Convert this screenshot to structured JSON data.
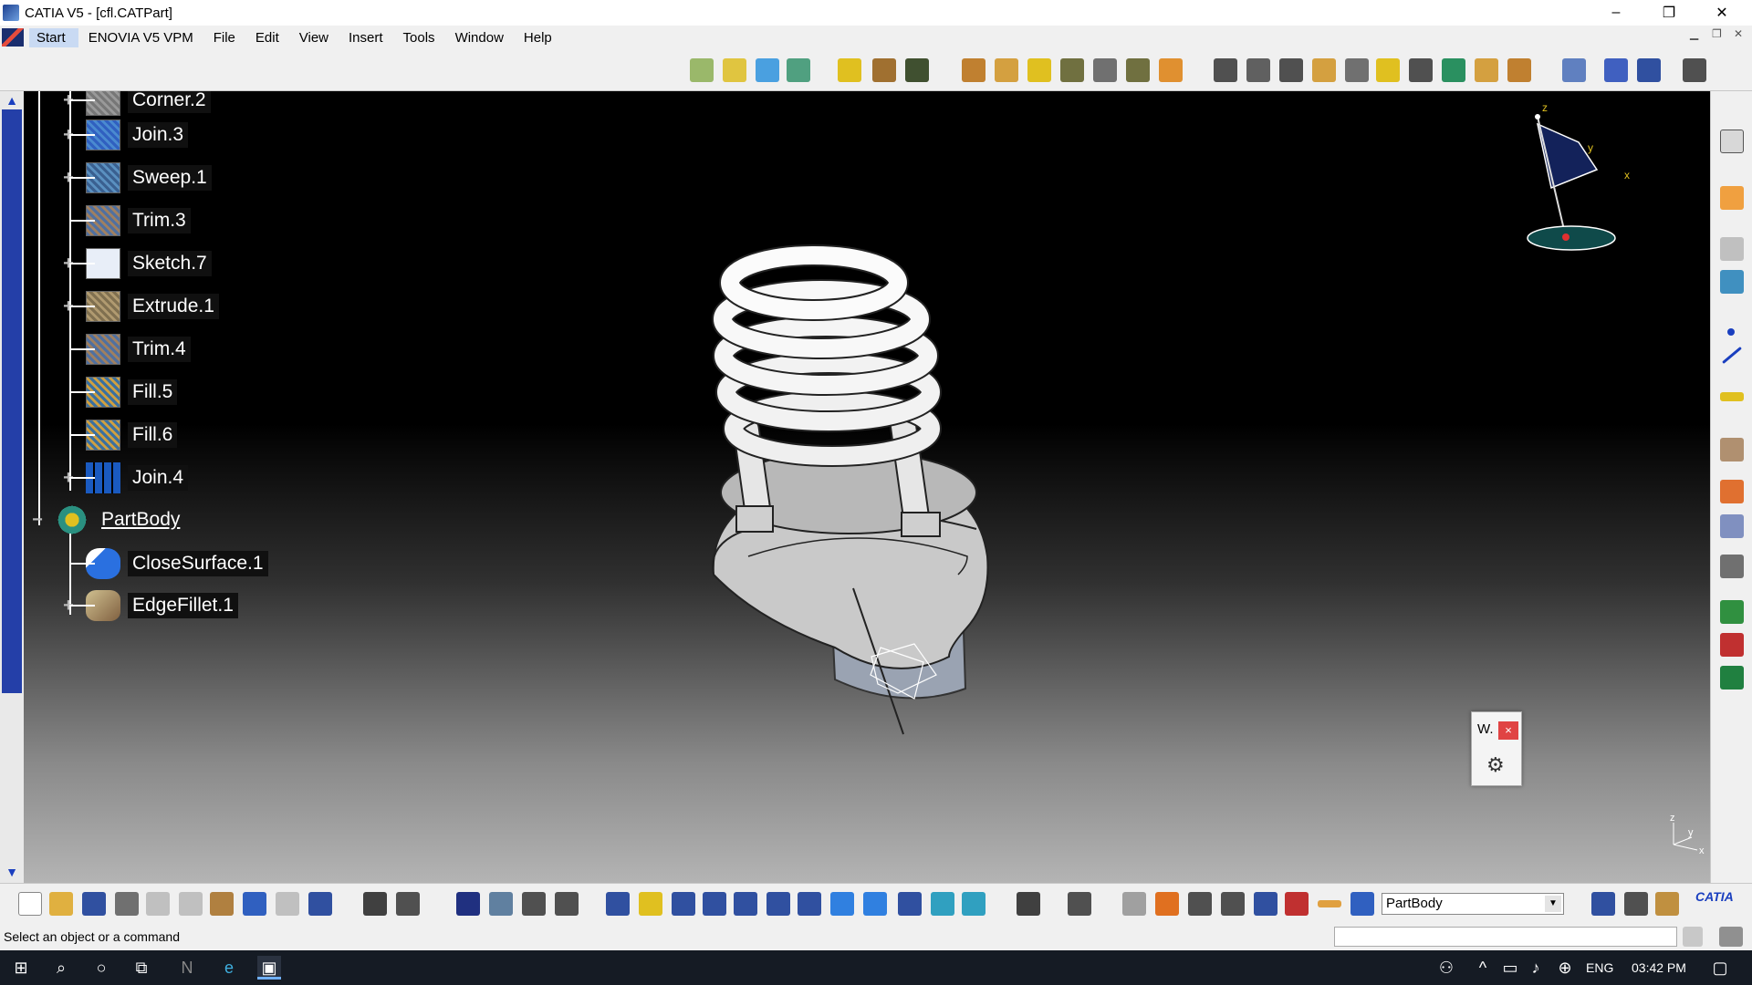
{
  "window": {
    "title": "CATIA V5 - [cfl.CATPart]",
    "minimize": "–",
    "restore": "❐",
    "close": "✕"
  },
  "menu": {
    "items": [
      "Start",
      "ENOVIA V5 VPM",
      "File",
      "Edit",
      "View",
      "Insert",
      "Tools",
      "Window",
      "Help"
    ]
  },
  "tree": {
    "nodes": [
      {
        "label": "Corner.2",
        "icon": "corner-icon",
        "expandable": true
      },
      {
        "label": "Join.3",
        "icon": "join-icon",
        "expandable": true
      },
      {
        "label": "Sweep.1",
        "icon": "sweep-icon",
        "expandable": true
      },
      {
        "label": "Trim.3",
        "icon": "trim-icon",
        "expandable": false
      },
      {
        "label": "Sketch.7",
        "icon": "sketch-icon",
        "expandable": true
      },
      {
        "label": "Extrude.1",
        "icon": "extrude-icon",
        "expandable": true
      },
      {
        "label": "Trim.4",
        "icon": "trim-icon",
        "expandable": false
      },
      {
        "label": "Fill.5",
        "icon": "fill-icon",
        "expandable": false
      },
      {
        "label": "Fill.6",
        "icon": "fill-icon",
        "expandable": false
      },
      {
        "label": "Join.4",
        "icon": "join-icon",
        "expandable": true
      },
      {
        "label": "PartBody",
        "icon": "partbody-icon",
        "expandable": true
      },
      {
        "label": "CloseSurface.1",
        "icon": "closesurface-icon",
        "expandable": false
      },
      {
        "label": "EdgeFillet.1",
        "icon": "edgefillet-icon",
        "expandable": true
      }
    ]
  },
  "compass": {
    "z": "z",
    "y": "y",
    "x": "x"
  },
  "axis_small": {
    "z": "z",
    "y": "y",
    "x": "x"
  },
  "window_dialog": {
    "label": "W.",
    "close": "×"
  },
  "bottom_toolbar": {
    "body_select": "PartBody"
  },
  "status": {
    "text": "Select an object or a command"
  },
  "taskbar": {
    "language": "ENG",
    "time": "03:42 PM"
  },
  "colors": {
    "viewport_top": "#000000",
    "viewport_bottom": "#b4b4b4",
    "selection_blue": "#243fa8",
    "model_surface": "#c8c8c8"
  }
}
